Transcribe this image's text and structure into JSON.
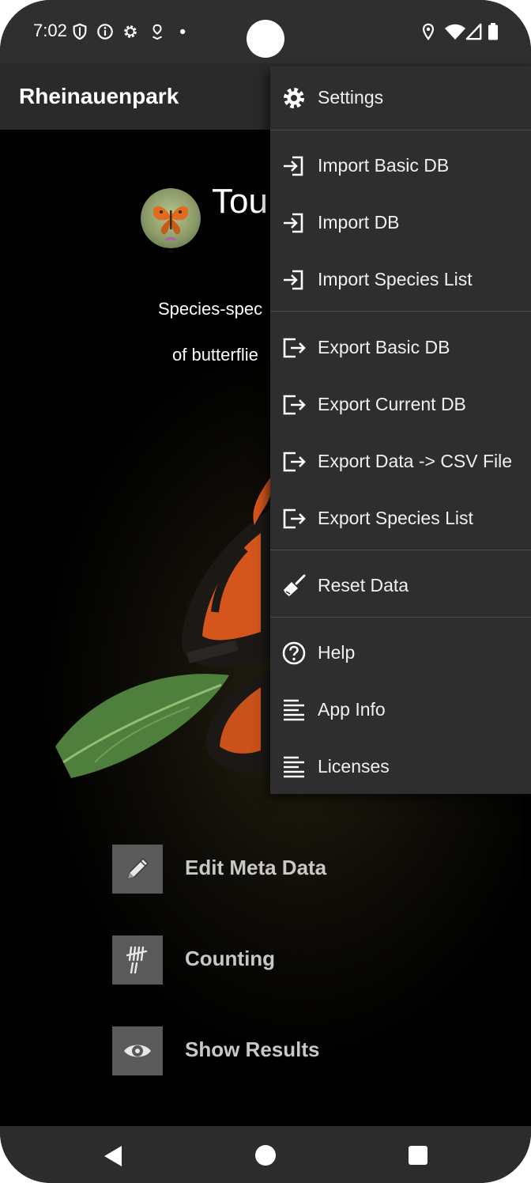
{
  "status_bar": {
    "time": "7:02",
    "left_icons": [
      "shield-icon",
      "info-icon",
      "settings-gear-icon",
      "location-pin-small-icon",
      "dot-icon"
    ],
    "right_icons": [
      "location-icon",
      "wifi-icon",
      "signal-icon",
      "battery-icon"
    ]
  },
  "app_bar": {
    "title": "Rheinauenpark"
  },
  "main": {
    "headline": "Tou",
    "subtitle_line1": "Species-spec",
    "subtitle_line2": "of butterflie",
    "actions": [
      {
        "label": "Edit Meta Data",
        "icon": "pencil-icon"
      },
      {
        "label": "Counting",
        "icon": "tally-icon"
      },
      {
        "label": "Show Results",
        "icon": "eye-icon"
      }
    ]
  },
  "menu": {
    "items": [
      {
        "label": "Settings",
        "icon": "gear-icon"
      },
      {
        "label": "Import Basic DB",
        "icon": "import-icon"
      },
      {
        "label": "Import DB",
        "icon": "import-icon"
      },
      {
        "label": "Import Species List",
        "icon": "import-icon"
      },
      {
        "label": "Export Basic DB",
        "icon": "export-icon"
      },
      {
        "label": "Export Current DB",
        "icon": "export-icon"
      },
      {
        "label": "Export Data -> CSV File",
        "icon": "export-icon"
      },
      {
        "label": "Export Species List",
        "icon": "export-icon"
      },
      {
        "label": "Reset Data",
        "icon": "broom-icon"
      },
      {
        "label": "Help",
        "icon": "help-icon"
      },
      {
        "label": "App Info",
        "icon": "text-lines-icon"
      },
      {
        "label": "Licenses",
        "icon": "text-lines-icon"
      }
    ]
  },
  "nav_bar": {
    "buttons": [
      "back-icon",
      "home-icon",
      "recents-icon"
    ]
  },
  "colors": {
    "status_bar_bg": "#2f2f2f",
    "app_bar_bg": "#2a2a2a",
    "menu_bg": "#2e2e2e",
    "action_button_bg": "#5a5a5a",
    "action_label": "#c8c8c8"
  }
}
